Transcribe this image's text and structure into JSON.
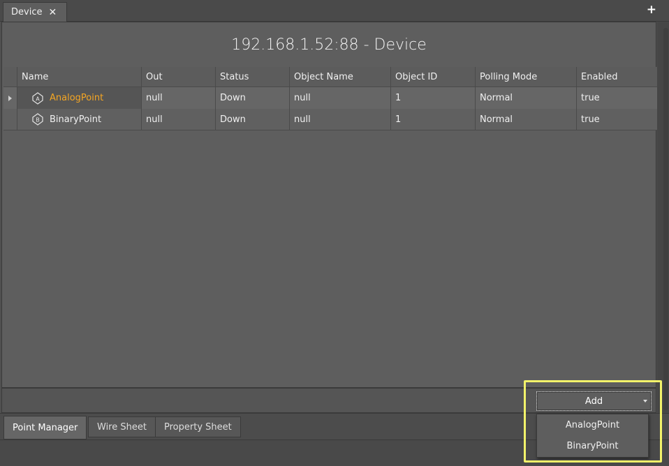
{
  "tab": {
    "label": "Device",
    "close_icon": "close-icon",
    "add_icon": "plus-icon"
  },
  "title": "192.168.1.52:88 - Device",
  "table": {
    "columns": [
      "Name",
      "Out",
      "Status",
      "Object Name",
      "Object ID",
      "Polling Mode",
      "Enabled"
    ],
    "rows": [
      {
        "name": "AnalogPoint",
        "icon": "analog-point-icon",
        "out": "null",
        "status": "Down",
        "object_name": "null",
        "object_id": "1",
        "polling_mode": "Normal",
        "enabled": "true"
      },
      {
        "name": "BinaryPoint",
        "icon": "binary-point-icon",
        "out": "null",
        "status": "Down",
        "object_name": "null",
        "object_id": "1",
        "polling_mode": "Normal",
        "enabled": "true"
      }
    ]
  },
  "add_button": {
    "label": "Add"
  },
  "add_menu": {
    "items": [
      "AnalogPoint",
      "BinaryPoint"
    ]
  },
  "view_tabs": [
    "Point Manager",
    "Wire Sheet",
    "Property Sheet"
  ],
  "colors": {
    "selected_name": "#f5a623",
    "highlight": "#f2f26a",
    "background": "#5e5e5e"
  }
}
